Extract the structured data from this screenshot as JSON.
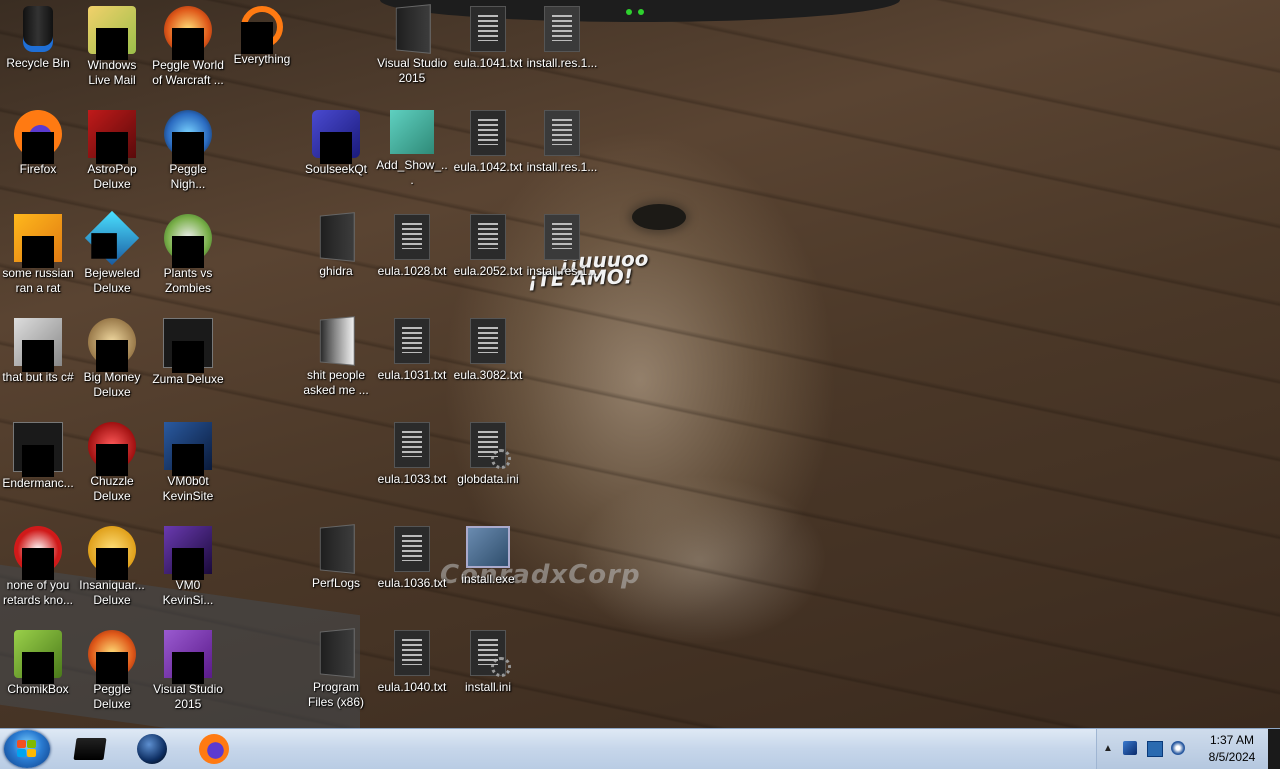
{
  "wallpaper": {
    "line1": "¡¡uuuoo",
    "line2": "¡TE AMO!",
    "watermark": "ConradxCorp"
  },
  "desktop_icons": [
    {
      "label": "Recycle Bin",
      "icon": "recycle-bin-icon"
    },
    {
      "label": "Windows Live Mail",
      "icon": "mail-icon"
    },
    {
      "label": "Peggle World of Warcraft ...",
      "icon": "game-icon"
    },
    {
      "label": "Everything",
      "icon": "search-icon"
    },
    {
      "label": "Visual Studio 2015",
      "icon": "folder-icon"
    },
    {
      "label": "eula.1041.txt",
      "icon": "text-file-icon"
    },
    {
      "label": "install.res.1...",
      "icon": "resource-file-icon"
    },
    {
      "label": "Firefox",
      "icon": "firefox-icon"
    },
    {
      "label": "AstroPop Deluxe",
      "icon": "game-icon"
    },
    {
      "label": "Peggle Nigh...",
      "icon": "game-icon"
    },
    {
      "label": "SoulseekQt",
      "icon": "app-icon"
    },
    {
      "label": "Add_Show_...",
      "icon": "registry-file-icon"
    },
    {
      "label": "eula.1042.txt",
      "icon": "text-file-icon"
    },
    {
      "label": "install.res.1...",
      "icon": "resource-file-icon"
    },
    {
      "label": "some russian ran a rat",
      "icon": "app-icon"
    },
    {
      "label": "Bejeweled Deluxe",
      "icon": "game-icon"
    },
    {
      "label": "Plants vs Zombies",
      "icon": "game-icon"
    },
    {
      "label": "ghidra",
      "icon": "folder-icon"
    },
    {
      "label": "eula.1028.txt",
      "icon": "text-file-icon"
    },
    {
      "label": "eula.2052.txt",
      "icon": "text-file-icon"
    },
    {
      "label": "install.res.1...",
      "icon": "resource-file-icon"
    },
    {
      "label": "that but its c#",
      "icon": "app-icon"
    },
    {
      "label": "Big Money Deluxe",
      "icon": "game-icon"
    },
    {
      "label": "Zuma Deluxe",
      "icon": "game-icon"
    },
    {
      "label": "shit people asked me ...",
      "icon": "folder-icon"
    },
    {
      "label": "eula.1031.txt",
      "icon": "text-file-icon"
    },
    {
      "label": "eula.3082.txt",
      "icon": "text-file-icon"
    },
    {
      "label": "Endermanc...",
      "icon": "app-icon"
    },
    {
      "label": "Chuzzle Deluxe",
      "icon": "game-icon"
    },
    {
      "label": "VM0b0t KevinSite",
      "icon": "app-icon"
    },
    {
      "label": "eula.1033.txt",
      "icon": "text-file-icon"
    },
    {
      "label": "globdata.ini",
      "icon": "settings-file-icon"
    },
    {
      "label": "none of you retards kno...",
      "icon": "app-icon"
    },
    {
      "label": "Insaniquar... Deluxe",
      "icon": "game-icon"
    },
    {
      "label": "VM0 KevinSi...",
      "icon": "app-icon"
    },
    {
      "label": "PerfLogs",
      "icon": "folder-icon"
    },
    {
      "label": "eula.1036.txt",
      "icon": "text-file-icon"
    },
    {
      "label": "install.exe",
      "icon": "installer-icon"
    },
    {
      "label": "ChomikBox",
      "icon": "app-icon"
    },
    {
      "label": "Peggle Deluxe",
      "icon": "game-icon"
    },
    {
      "label": "Visual Studio 2015",
      "icon": "visual-studio-icon"
    },
    {
      "label": "Program Files (x86)",
      "icon": "folder-icon"
    },
    {
      "label": "eula.1040.txt",
      "icon": "text-file-icon"
    },
    {
      "label": "install.ini",
      "icon": "settings-file-icon"
    }
  ],
  "taskbar": {
    "pinned": [
      "terminal-icon",
      "globe-icon",
      "firefox-icon"
    ],
    "clock": {
      "time": "1:37 AM",
      "date": "8/5/2024"
    }
  },
  "colors": {
    "taskbar": "#c6d6ea",
    "label_text": "#ffffff"
  }
}
